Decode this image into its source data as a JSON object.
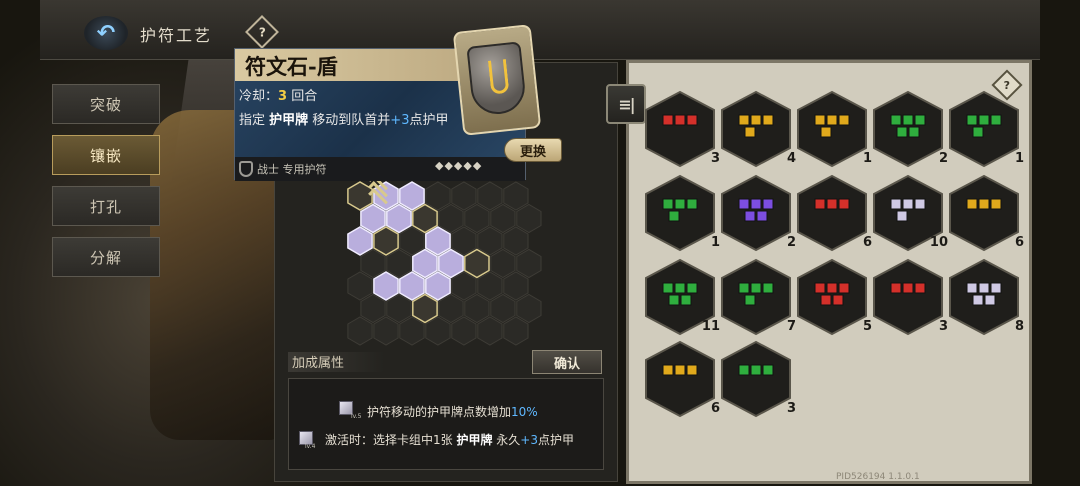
{
  "header": {
    "title": "护符工艺",
    "back_icon": "back-arrow-icon",
    "help_icon": "help-diamond-icon",
    "help_glyph": "?"
  },
  "tabs": [
    {
      "label": "突破",
      "active": false
    },
    {
      "label": "镶嵌",
      "active": true
    },
    {
      "label": "打孔",
      "active": false
    },
    {
      "label": "分解",
      "active": false
    }
  ],
  "card": {
    "title": "符文石-盾",
    "cooldown_prefix": "冷却：",
    "cooldown_value": "3",
    "cooldown_unit": "回合",
    "effect_part1": "指定 ",
    "effect_keyword": "护甲牌",
    "effect_part2": " 移动到队首并",
    "effect_value": "+3",
    "effect_part3": "点护甲",
    "class_label": "战士 专用护符",
    "replace_label": "更换"
  },
  "bonus": {
    "label": "加成属性",
    "confirm_label": "确认",
    "line1_prefix": "护符移动的护甲牌点数增加",
    "line1_value": "10%",
    "line1_level": "lv.5",
    "line2_prefix": "激活时：选择卡组中1张 ",
    "line2_keyword": "护甲牌",
    "line2_mid": " 永久",
    "line2_value": "+3",
    "line2_suffix": "点护甲",
    "line2_level": "lv.4"
  },
  "inventory": {
    "toggle_icon": "list-toggle-icon",
    "toggle_glyph": "≡|",
    "help_icon": "help-diamond-icon",
    "help_glyph": "?",
    "items": [
      {
        "color": "red",
        "count": "3"
      },
      {
        "color": "gold",
        "count": "4"
      },
      {
        "color": "gold",
        "count": "1"
      },
      {
        "color": "green",
        "count": "2"
      },
      {
        "color": "green",
        "count": "1"
      },
      {
        "color": "green",
        "count": "1"
      },
      {
        "color": "purple",
        "count": "2"
      },
      {
        "color": "red",
        "count": "6"
      },
      {
        "color": "white",
        "count": "10"
      },
      {
        "color": "gold",
        "count": "6"
      },
      {
        "color": "green",
        "count": "11"
      },
      {
        "color": "green",
        "count": "7"
      },
      {
        "color": "red",
        "count": "5"
      },
      {
        "color": "red",
        "count": "3"
      },
      {
        "color": "white",
        "count": "8"
      },
      {
        "color": "gold",
        "count": "6"
      },
      {
        "color": "green",
        "count": "3"
      }
    ]
  },
  "footer": {
    "version": "PID526194  1.1.0.1"
  },
  "colors": {
    "red": "#d4302a",
    "gold": "#e0a91c",
    "green": "#2fae3e",
    "purple": "#7c4ee0",
    "white": "#cfc9e4",
    "accent_blue": "#5fb8ff",
    "accent_yellow": "#f3cd45"
  }
}
